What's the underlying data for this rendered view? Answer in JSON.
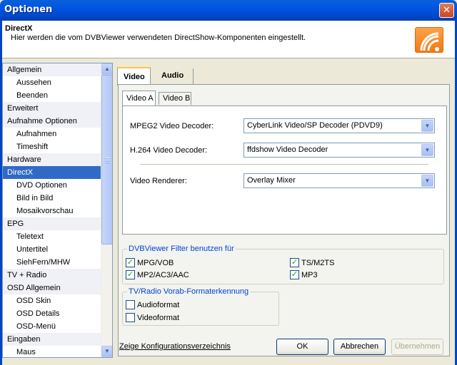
{
  "window": {
    "title": "Optionen",
    "close_label": "✕"
  },
  "header": {
    "title": "DirectX",
    "description": "Hier werden die vom DVBViewer verwendeten DirectShow-Komponenten eingestellt."
  },
  "nav": {
    "items": [
      {
        "label": "Allgemein",
        "kind": "cat"
      },
      {
        "label": "Aussehen",
        "kind": "sub"
      },
      {
        "label": "Beenden",
        "kind": "sub"
      },
      {
        "label": "Erweitert",
        "kind": "cat"
      },
      {
        "label": "Aufnahme Optionen",
        "kind": "cat"
      },
      {
        "label": "Aufnahmen",
        "kind": "sub"
      },
      {
        "label": "Timeshift",
        "kind": "sub"
      },
      {
        "label": "Hardware",
        "kind": "cat"
      },
      {
        "label": "DirectX",
        "kind": "cat",
        "selected": true
      },
      {
        "label": "DVD Optionen",
        "kind": "sub"
      },
      {
        "label": "Bild in Bild",
        "kind": "sub"
      },
      {
        "label": "Mosaikvorschau",
        "kind": "sub"
      },
      {
        "label": "EPG",
        "kind": "cat"
      },
      {
        "label": "Teletext",
        "kind": "sub"
      },
      {
        "label": "Untertitel",
        "kind": "sub"
      },
      {
        "label": "SiehFern/MHW",
        "kind": "sub"
      },
      {
        "label": "TV + Radio",
        "kind": "cat"
      },
      {
        "label": "OSD Allgemein",
        "kind": "cat"
      },
      {
        "label": "OSD Skin",
        "kind": "sub"
      },
      {
        "label": "OSD Details",
        "kind": "sub"
      },
      {
        "label": "OSD-Menü",
        "kind": "sub"
      },
      {
        "label": "Eingaben",
        "kind": "cat"
      },
      {
        "label": "Maus",
        "kind": "sub"
      }
    ]
  },
  "tabs": {
    "outer": [
      {
        "label": "Video",
        "active": true
      },
      {
        "label": "Audio",
        "active": false
      }
    ],
    "inner": [
      {
        "label": "Video A",
        "active": true
      },
      {
        "label": "Video B",
        "active": false
      }
    ]
  },
  "video_a": {
    "mpeg2_label": "MPEG2 Video Decoder:",
    "mpeg2_value": "CyberLink Video/SP Decoder (PDVD9)",
    "h264_label": "H.264 Video Decoder:",
    "h264_value": "ffdshow Video Decoder",
    "renderer_label": "Video Renderer:",
    "renderer_value": "Overlay Mixer"
  },
  "filter_group": {
    "title": "DVBViewer Filter benutzen für",
    "options": [
      {
        "label": "MPG/VOB",
        "checked": true
      },
      {
        "label": "TS/M2TS",
        "checked": true
      },
      {
        "label": "MP2/AC3/AAC",
        "checked": true
      },
      {
        "label": "MP3",
        "checked": true
      }
    ]
  },
  "format_group": {
    "title": "TV/Radio Vorab-Formaterkennung",
    "options": [
      {
        "label": "Audioformat",
        "checked": false
      },
      {
        "label": "Videoformat",
        "checked": false
      }
    ]
  },
  "footer": {
    "link_label": "Zeige Konfigurationsverzeichnis",
    "ok_label": "OK",
    "cancel_label": "Abbrechen",
    "apply_label": "Übernehmen"
  }
}
